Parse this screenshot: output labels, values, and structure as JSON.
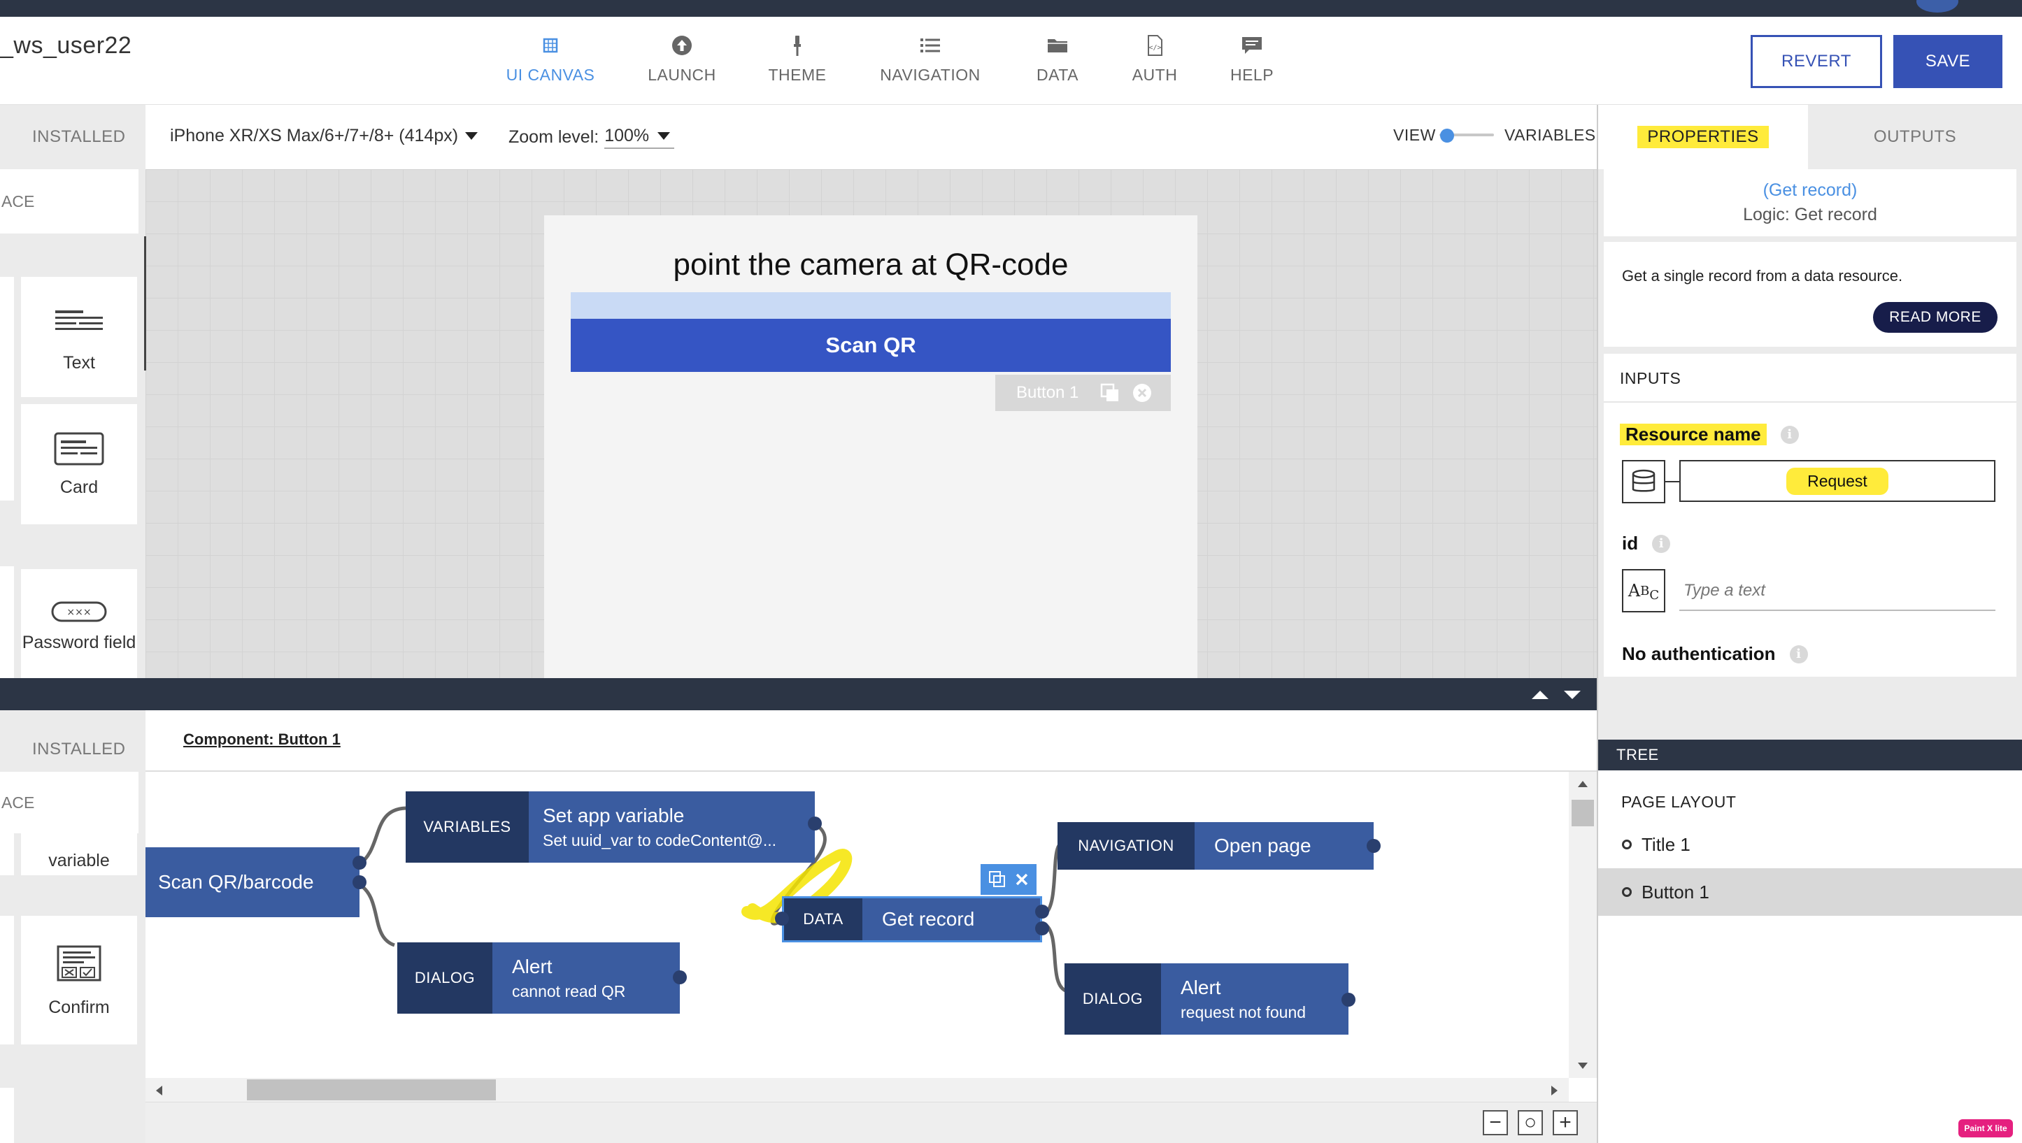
{
  "app": {
    "title": "_ws_user22"
  },
  "nav": {
    "tabs": [
      {
        "label": "UI CANVAS",
        "icon": "ui-canvas-icon",
        "active": true
      },
      {
        "label": "LAUNCH",
        "icon": "launch-icon"
      },
      {
        "label": "THEME",
        "icon": "theme-brush-icon"
      },
      {
        "label": "NAVIGATION",
        "icon": "navigation-list-icon"
      },
      {
        "label": "DATA",
        "icon": "data-folder-icon"
      },
      {
        "label": "AUTH",
        "icon": "auth-file-icon"
      },
      {
        "label": "HELP",
        "icon": "help-chat-icon"
      }
    ]
  },
  "header": {
    "revert_label": "REVERT",
    "save_label": "SAVE"
  },
  "left_top": {
    "tab_label": "INSTALLED",
    "space_label": "ACE",
    "widgets": [
      {
        "label": "Text"
      },
      {
        "label": "Card"
      },
      {
        "label": "Password field"
      }
    ]
  },
  "device_bar": {
    "device": "iPhone XR/XS Max/6+/7+/8+ (414px)",
    "zoom_label": "Zoom level:",
    "zoom_value": "100%",
    "view_label": "VIEW",
    "variables_label": "VARIABLES"
  },
  "canvas": {
    "screen_title": "point the camera at QR-code",
    "button_label": "Scan QR",
    "selected_tag": "Button 1"
  },
  "bottom": {
    "tab_label": "INSTALLED",
    "space_label": "ACE",
    "partial_widget": "variable",
    "widget": "Confirm",
    "component_label": "Component: Button 1"
  },
  "logic": {
    "nodes": {
      "scan": {
        "title": "Scan QR/barcode"
      },
      "setvar": {
        "category": "VARIABLES",
        "title": "Set app variable",
        "subtitle": "Set uuid_var to codeContent@..."
      },
      "alert1": {
        "category": "DIALOG",
        "title": "Alert",
        "subtitle": "cannot read QR"
      },
      "getrec": {
        "category": "DATA",
        "title": "Get record"
      },
      "openpage": {
        "category": "NAVIGATION",
        "title": "Open page"
      },
      "alert2": {
        "category": "DIALOG",
        "title": "Alert",
        "subtitle": "request not found"
      }
    },
    "zoom_controls": {
      "minus": "−",
      "reset": "○",
      "plus": "+"
    }
  },
  "right": {
    "tab_properties": "PROPERTIES",
    "tab_outputs": "OUTPUTS",
    "record_link": "(Get record)",
    "record_sub": "Logic: Get record",
    "description": "Get a single record from a data resource.",
    "read_more": "READ MORE",
    "inputs_label": "INPUTS",
    "resource_label": "Resource name",
    "resource_value": "Request",
    "id_label": "id",
    "id_placeholder": "Type a text",
    "auth_label": "No authentication",
    "tree_label": "TREE",
    "page_layout_label": "PAGE LAYOUT",
    "tree_items": [
      {
        "label": "Title 1"
      },
      {
        "label": "Button 1",
        "selected": true
      }
    ]
  },
  "badge": {
    "label": "Paint X lite"
  },
  "colors": {
    "accent": "#3652b5",
    "node_blue": "#3a5ca0",
    "node_dark": "#233862",
    "highlight": "#ffeb3b",
    "dark_bar": "#2c3545",
    "link": "#4a90e2"
  }
}
